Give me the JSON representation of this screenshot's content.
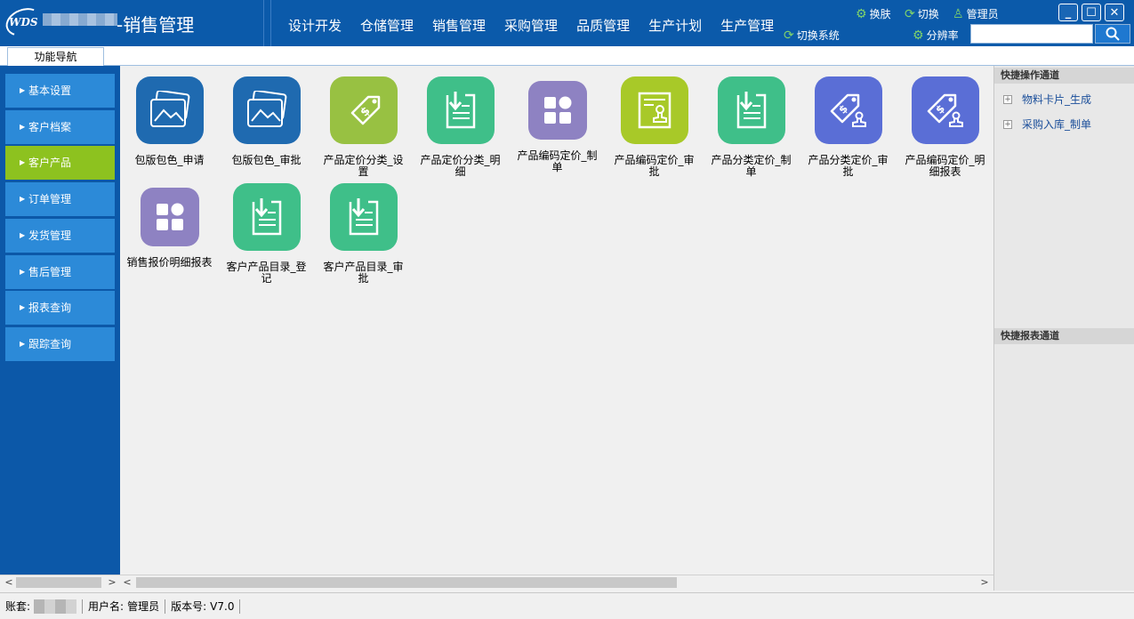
{
  "header": {
    "logo_text": "WDS",
    "app_title": "-销售管理",
    "menu": [
      "设计开发",
      "仓储管理",
      "销售管理",
      "采购管理",
      "品质管理",
      "生产计划",
      "生产管理"
    ],
    "switch_system": "切换系统",
    "skin": "换肤",
    "switch": "切换",
    "user": "管理员",
    "resolution": "分辨率",
    "search_placeholder": ""
  },
  "tabs": {
    "nav_tab": "功能导航"
  },
  "sidebar": {
    "items": [
      {
        "label": "基本设置",
        "active": false
      },
      {
        "label": "客户档案",
        "active": false
      },
      {
        "label": "客户产品",
        "active": true
      },
      {
        "label": "订单管理",
        "active": false
      },
      {
        "label": "发货管理",
        "active": false
      },
      {
        "label": "售后管理",
        "active": false
      },
      {
        "label": "报表查询",
        "active": false
      },
      {
        "label": "跟踪查询",
        "active": false
      }
    ]
  },
  "apps": [
    {
      "label": "包版包色_申请",
      "icon": "image-icon",
      "color": "#1f6ab0"
    },
    {
      "label": "包版包色_审批",
      "icon": "image-icon",
      "color": "#1f6ab0"
    },
    {
      "label": "产品定价分类_设置",
      "icon": "price-tag-icon",
      "color": "#98c142"
    },
    {
      "label": "产品定价分类_明细",
      "icon": "download-doc-icon",
      "color": "#3fbf89"
    },
    {
      "label": "产品编码定价_制单",
      "icon": "grid-icon",
      "color": "#8e82c2"
    },
    {
      "label": "产品编码定价_审批",
      "icon": "stamp-doc-icon",
      "color": "#a8c928"
    },
    {
      "label": "产品分类定价_制单",
      "icon": "download-doc-icon",
      "color": "#3fbf89"
    },
    {
      "label": "产品分类定价_审批",
      "icon": "price-stamp-icon",
      "color": "#5a6ed6"
    },
    {
      "label": "产品编码定价_明细报表",
      "icon": "price-stamp-icon",
      "color": "#5a6ed6"
    },
    {
      "label": "销售报价明细报表",
      "icon": "grid-icon",
      "color": "#8e82c2"
    },
    {
      "label": "客户产品目录_登记",
      "icon": "download-doc-icon",
      "color": "#3fbf89"
    },
    {
      "label": "客户产品目录_审批",
      "icon": "download-doc-icon",
      "color": "#3fbf89"
    }
  ],
  "right_panel": {
    "quick_ops_title": "快捷操作通道",
    "quick_ops": [
      "物料卡片_生成",
      "采购入库_制单"
    ],
    "quick_reports_title": "快捷报表通道"
  },
  "status": {
    "account_label": "账套:",
    "username_label": "用户名:",
    "username": "管理员",
    "version_label": "版本号:",
    "version": "V7.0"
  }
}
